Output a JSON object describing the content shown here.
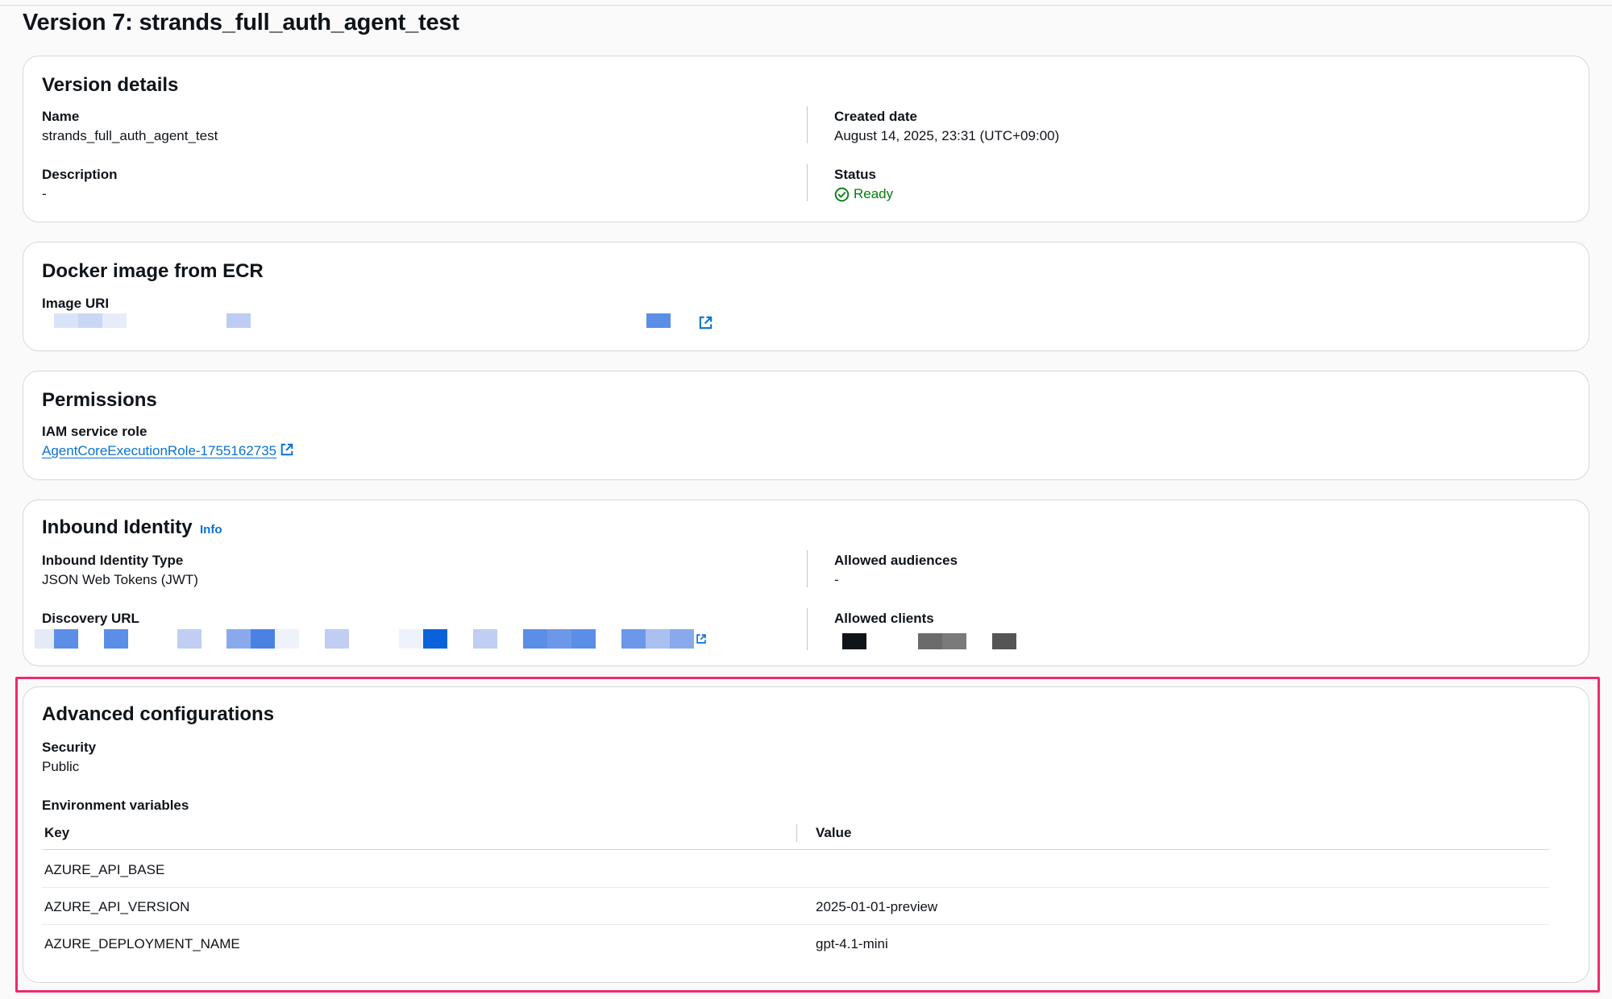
{
  "page": {
    "title": "Version 7: strands_full_auth_agent_test"
  },
  "version_details": {
    "title": "Version details",
    "name_label": "Name",
    "name_value": "strands_full_auth_agent_test",
    "description_label": "Description",
    "description_value": "-",
    "created_label": "Created date",
    "created_value": "August 14, 2025, 23:31 (UTC+09:00)",
    "status_label": "Status",
    "status_value": "Ready"
  },
  "docker": {
    "title": "Docker image from ECR",
    "image_uri_label": "Image URI"
  },
  "permissions": {
    "title": "Permissions",
    "iam_label": "IAM service role",
    "iam_value": "AgentCoreExecutionRole-1755162735"
  },
  "inbound": {
    "title": "Inbound Identity",
    "info_label": "Info",
    "type_label": "Inbound Identity Type",
    "type_value": "JSON Web Tokens (JWT)",
    "discovery_label": "Discovery URL",
    "audiences_label": "Allowed audiences",
    "audiences_value": "-",
    "clients_label": "Allowed clients"
  },
  "advanced": {
    "title": "Advanced configurations",
    "security_label": "Security",
    "security_value": "Public",
    "env_label": "Environment variables",
    "columns": {
      "key": "Key",
      "value": "Value"
    },
    "rows": [
      {
        "key": "AZURE_API_BASE",
        "value": ""
      },
      {
        "key": "AZURE_API_VERSION",
        "value": "2025-01-01-preview"
      },
      {
        "key": "AZURE_DEPLOYMENT_NAME",
        "value": "gpt-4.1-mini"
      }
    ]
  },
  "colors": {
    "link": "#0972d3",
    "success": "#037f0c",
    "highlight": "#ec2b6f"
  }
}
